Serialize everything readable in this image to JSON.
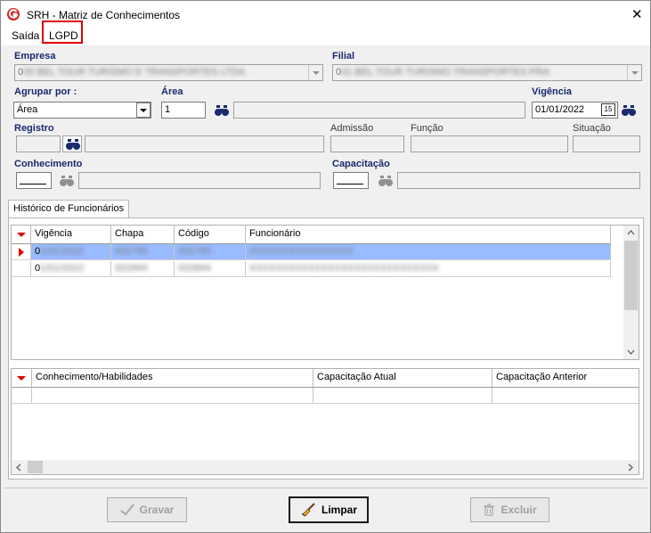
{
  "window": {
    "title": "SRH - Matriz de Conhecimentos",
    "close_glyph": "✕"
  },
  "menu": {
    "items": [
      "Saída",
      "LGPD"
    ]
  },
  "form": {
    "empresa": {
      "label": "Empresa",
      "value_prefix": "0",
      "value_hidden": "00 BEL TOUR TURISMO E TRANSPORTES LTDA"
    },
    "filial": {
      "label": "Filial",
      "value_prefix": "0",
      "value_hidden": "01 BEL TOUR TURISMO TRANSPORTES PRA"
    },
    "agrupar": {
      "label": "Agrupar por :",
      "value": "Área"
    },
    "area": {
      "label": "Área",
      "value": "1"
    },
    "vigencia": {
      "label": "Vigência",
      "value": "01/01/2022",
      "cal_icon_text": "15"
    },
    "registro": {
      "label": "Registro"
    },
    "admissao": {
      "label": "Admissão"
    },
    "funcao": {
      "label": "Função"
    },
    "situacao": {
      "label": "Situação"
    },
    "conhecimento": {
      "label": "Conhecimento"
    },
    "capacitacao": {
      "label": "Capacitação"
    }
  },
  "tab": {
    "label": "Histórico de Funcionários"
  },
  "grid1": {
    "headers": [
      "Vigência",
      "Chapa",
      "Código",
      "Funcionário"
    ],
    "rows": [
      {
        "vigencia_prefix": "0",
        "vigencia_hidden": "1/01/2022",
        "chapa_hidden": "002795",
        "codigo_hidden": "002795",
        "func_hidden": "XXXXXXXXXXXXXXXX",
        "selected": true
      },
      {
        "vigencia_prefix": "0",
        "vigencia_hidden": "1/01/2022",
        "chapa_hidden": "002894",
        "codigo_hidden": "002894",
        "func_hidden": "XXXXXXXXXXXXXXXXXXXXXXXXXXXXX",
        "selected": false
      }
    ]
  },
  "grid2": {
    "headers": [
      "Conhecimento/Habilidades",
      "Capacitação Atual",
      "Capacitação Anterior"
    ]
  },
  "buttons": {
    "gravar": "Gravar",
    "limpar": "Limpar",
    "excluir": "Excluir"
  },
  "colors": {
    "selected_row": "#99bbff",
    "title_accent": "#1a2a6e",
    "highlight_box": "#e00000",
    "logo_red": "#d42020"
  }
}
